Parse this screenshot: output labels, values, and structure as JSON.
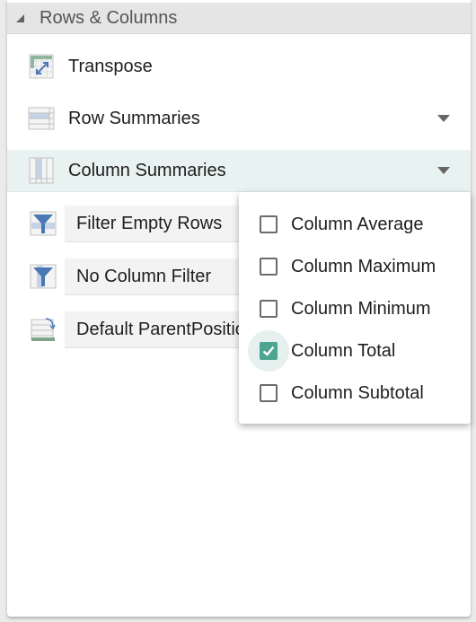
{
  "section": {
    "title": "Rows & Columns",
    "collapse_icon": "triangle-collapse-icon"
  },
  "items": [
    {
      "label": "Transpose",
      "icon": "transpose-icon",
      "has_dropdown": false
    },
    {
      "label": "Row Summaries",
      "icon": "row-summaries-icon",
      "has_dropdown": true
    },
    {
      "label": "Column Summaries",
      "icon": "column-summaries-icon",
      "has_dropdown": true,
      "active": true
    }
  ],
  "buttons": [
    {
      "label": "Filter Empty Rows",
      "icon": "filter-rows-icon"
    },
    {
      "label": "No Column Filter",
      "icon": "filter-columns-icon"
    },
    {
      "label": "Default ParentPosition",
      "icon": "parent-position-icon"
    }
  ],
  "column_summaries_menu": {
    "options": [
      {
        "label": "Column Average",
        "checked": false
      },
      {
        "label": "Column Maximum",
        "checked": false
      },
      {
        "label": "Column Minimum",
        "checked": false
      },
      {
        "label": "Column Total",
        "checked": true
      },
      {
        "label": "Column Subtotal",
        "checked": false
      }
    ]
  },
  "colors": {
    "accent": "#4da591",
    "active_row": "#e8f2f1",
    "header_bg": "#e5e5e5",
    "icon_blue": "#4a78b4"
  }
}
